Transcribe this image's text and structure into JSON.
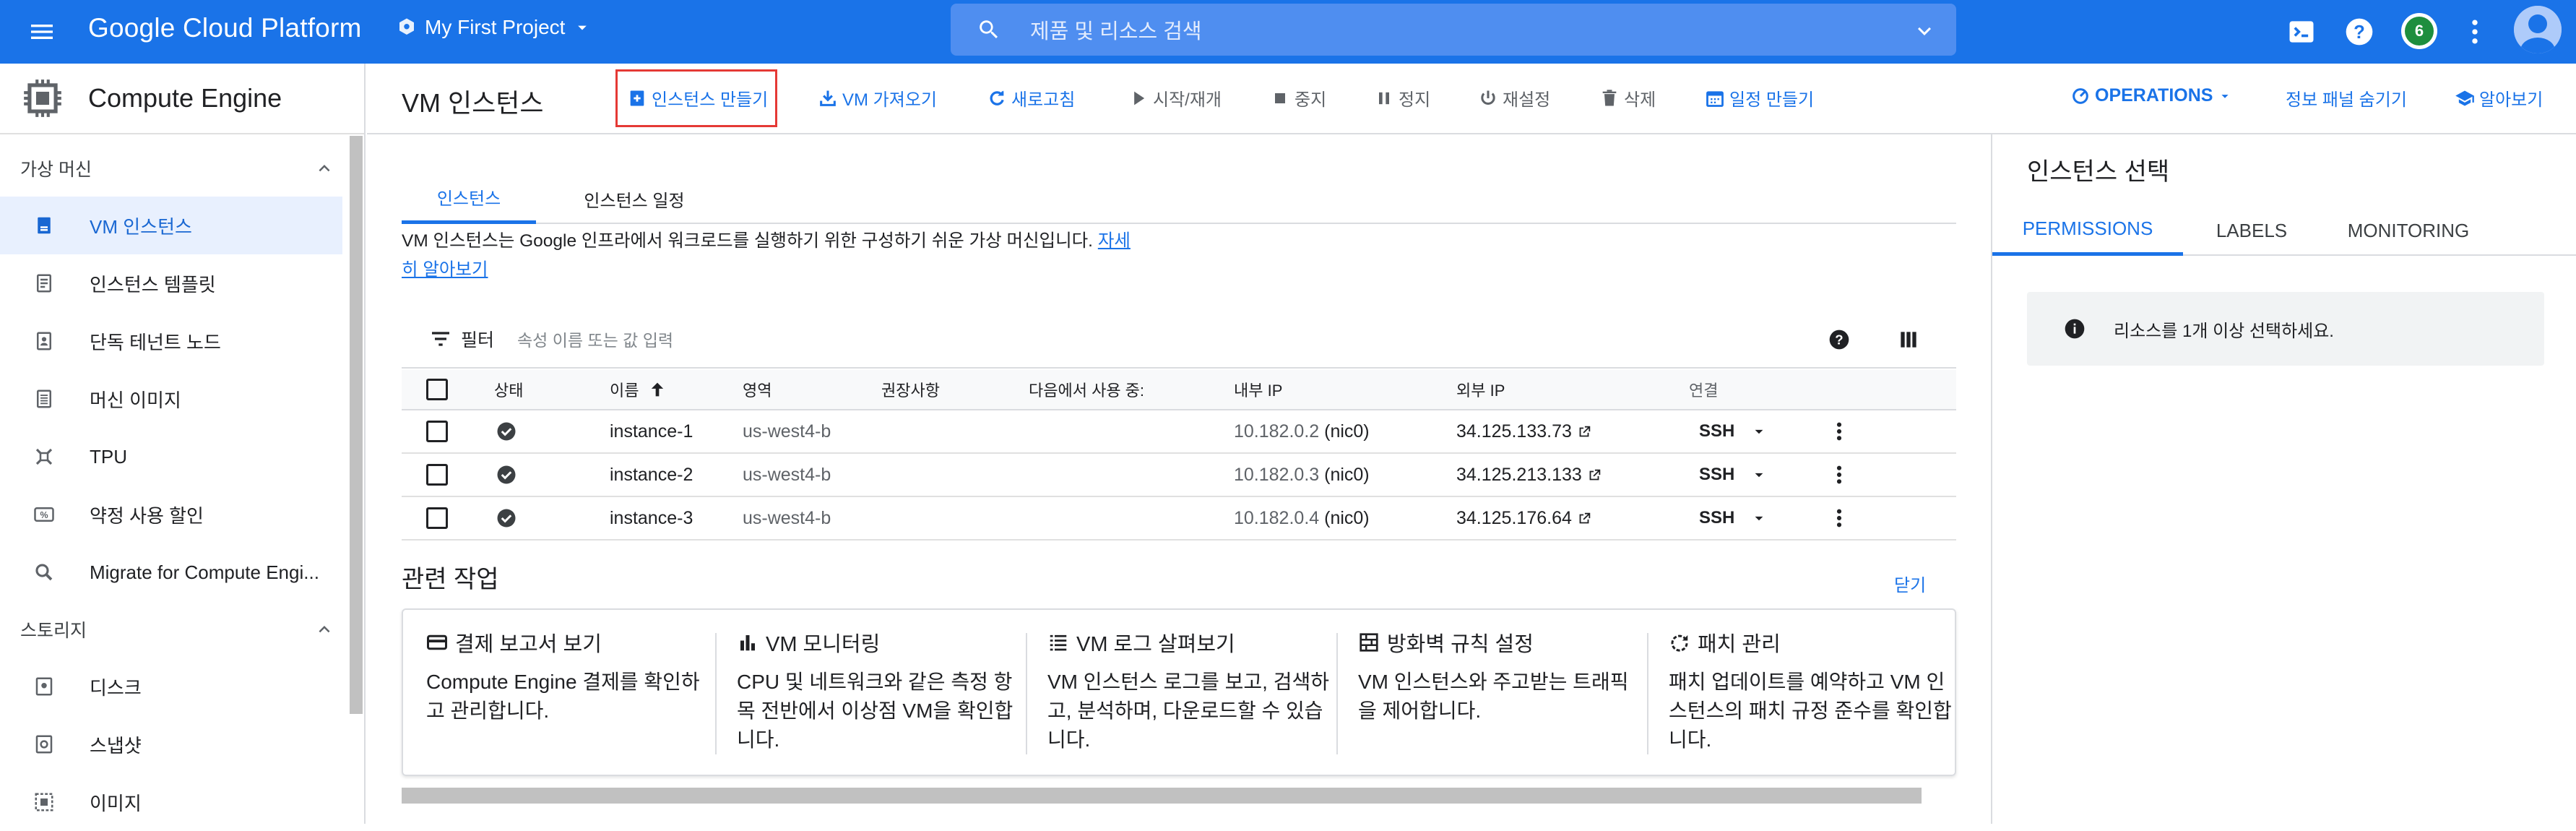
{
  "topbar": {
    "brand": "Google Cloud Platform",
    "project": "My First Project",
    "search_placeholder": "제품 및 리소스 검색",
    "notification_count": "6",
    "colors": {
      "bar": "#1a73e8",
      "search": "#4f8ef0"
    }
  },
  "sidenav": {
    "title": "Compute Engine",
    "section_vm": "가상 머신",
    "section_storage": "스토리지",
    "items": [
      {
        "label": "VM 인스턴스",
        "icon": "vm-instance-icon",
        "active": true
      },
      {
        "label": "인스턴스 템플릿",
        "icon": "template-icon"
      },
      {
        "label": "단독 테넌트 노드",
        "icon": "sole-tenant-icon"
      },
      {
        "label": "머신 이미지",
        "icon": "machine-image-icon"
      },
      {
        "label": "TPU",
        "icon": "tpu-icon"
      },
      {
        "label": "약정 사용 할인",
        "icon": "discount-icon"
      },
      {
        "label": "Migrate for Compute Engi...",
        "icon": "search-icon"
      }
    ],
    "storage_items": [
      {
        "label": "디스크",
        "icon": "disk-icon"
      },
      {
        "label": "스냅샷",
        "icon": "snapshot-icon"
      },
      {
        "label": "이미지",
        "icon": "image-icon"
      }
    ]
  },
  "toolbar": {
    "page_title": "VM 인스턴스",
    "create": "인스턴스 만들기",
    "import": "VM 가져오기",
    "refresh": "새로고침",
    "start": "시작/재개",
    "stop": "중지",
    "suspend": "정지",
    "reset": "재설정",
    "delete": "삭제",
    "schedule": "일정 만들기",
    "operations": "OPERATIONS",
    "hide_panel": "정보 패널 숨기기",
    "learn": "알아보기"
  },
  "main": {
    "tabs": [
      "인스턴스",
      "인스턴스 일정"
    ],
    "description": "VM 인스턴스는 Google 인프라에서 워크로드를 실행하기 위한 구성하기 쉬운 가상 머신입니다.",
    "learn_more_1": "자세",
    "learn_more_2": "히 알아보기",
    "filter_label": "필터",
    "filter_placeholder": "속성 이름 또는 값 입력",
    "columns": [
      "상태",
      "이름",
      "영역",
      "권장사항",
      "다음에서 사용 중:",
      "내부 IP",
      "외부 IP",
      "연결"
    ],
    "rows": [
      {
        "name": "instance-1",
        "zone": "us-west4-b",
        "internal_ip": "10.182.0.2",
        "nic": "(nic0)",
        "external_ip": "34.125.133.73",
        "connect": "SSH"
      },
      {
        "name": "instance-2",
        "zone": "us-west4-b",
        "internal_ip": "10.182.0.3",
        "nic": "(nic0)",
        "external_ip": "34.125.213.133",
        "connect": "SSH"
      },
      {
        "name": "instance-3",
        "zone": "us-west4-b",
        "internal_ip": "10.182.0.4",
        "nic": "(nic0)",
        "external_ip": "34.125.176.64",
        "connect": "SSH"
      }
    ],
    "related_title": "관련 작업",
    "close": "닫기",
    "cards": [
      {
        "title": "결제 보고서 보기",
        "icon": "billing-card-icon",
        "desc": "Compute Engine 결제를 확인하고 관리합니다."
      },
      {
        "title": "VM 모니터링",
        "icon": "bar-chart-icon",
        "desc": "CPU 및 네트워크와 같은 측정 항목 전반에서 이상점 VM을 확인합니다."
      },
      {
        "title": "VM 로그 살펴보기",
        "icon": "logs-icon",
        "desc": "VM 인스턴스 로그를 보고, 검색하고, 분석하며, 다운로드할 수 있습니다."
      },
      {
        "title": "방화벽 규칙 설정",
        "icon": "firewall-icon",
        "desc": "VM 인스턴스와 주고받는 트래픽을 제어합니다."
      },
      {
        "title": "패치 관리",
        "icon": "patch-icon",
        "desc": "패치 업데이트를 예약하고 VM 인스턴스의 패치 규정 준수를 확인합니다."
      }
    ]
  },
  "rpanel": {
    "title": "인스턴스 선택",
    "tabs": [
      "PERMISSIONS",
      "LABELS",
      "MONITORING"
    ],
    "info": "리소스를 1개 이상 선택하세요."
  }
}
